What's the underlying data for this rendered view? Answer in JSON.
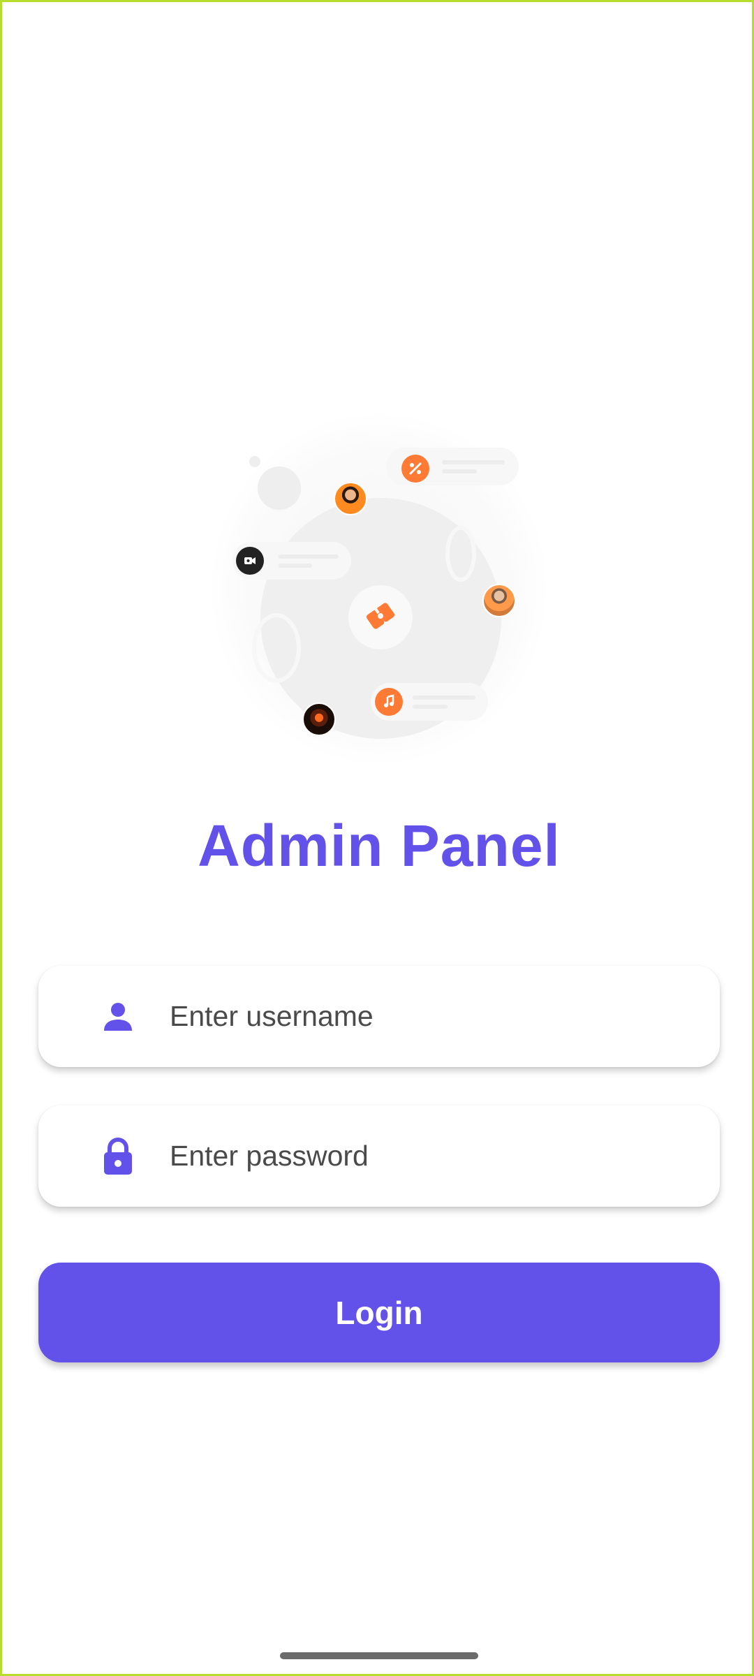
{
  "header": {
    "title": "Admin Panel"
  },
  "illustration": {
    "icons": [
      "percent-icon",
      "video-icon",
      "music-icon",
      "puzzle-icon"
    ],
    "accent_color": "#ff7a35",
    "dark_icon_color": "#222222"
  },
  "form": {
    "username": {
      "placeholder": "Enter username",
      "value": "",
      "icon": "person-icon"
    },
    "password": {
      "placeholder": "Enter password",
      "value": "",
      "icon": "lock-icon"
    },
    "login_label": "Login"
  },
  "colors": {
    "primary": "#6352ea",
    "background": "#ffffff",
    "frame": "#b6dc2e"
  }
}
